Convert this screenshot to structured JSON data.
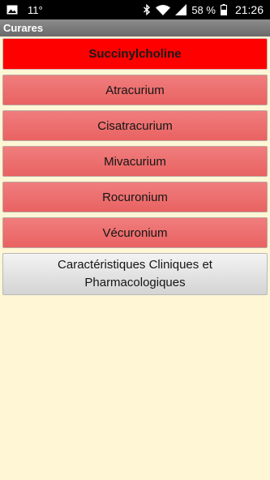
{
  "status_bar": {
    "temperature": "11°",
    "battery": "58 %",
    "time": "21:26"
  },
  "title_bar": {
    "title": "Curares"
  },
  "menu": {
    "primary_label": "Succinylcholine",
    "drugs": [
      {
        "label": "Atracurium"
      },
      {
        "label": "Cisatracurium"
      },
      {
        "label": "Mivacurium"
      },
      {
        "label": "Rocuronium"
      },
      {
        "label": "Vécuronium"
      }
    ],
    "info_label": "Caractéristiques Cliniques et Pharmacologiques"
  },
  "colors": {
    "background": "#fff6d6",
    "primary_button": "#ff0000",
    "drug_button": "#ee7070",
    "info_button": "#e3e3e3",
    "title_bar": "#7a7a7a"
  }
}
